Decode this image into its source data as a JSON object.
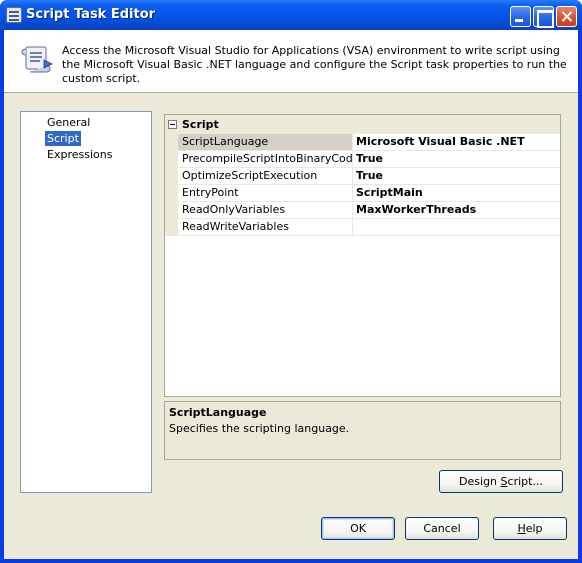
{
  "window": {
    "title": "Script Task Editor"
  },
  "header": {
    "description": "Access the Microsoft Visual Studio for Applications (VSA) environment to write script using the Microsoft Visual Basic .NET language and configure the Script task properties to run the custom script.",
    "icon": "script-scroll-icon"
  },
  "nav": {
    "items": [
      {
        "label": "General",
        "selected": false
      },
      {
        "label": "Script",
        "selected": true
      },
      {
        "label": "Expressions",
        "selected": false
      }
    ]
  },
  "grid": {
    "category": "Script",
    "rows": [
      {
        "name": "ScriptLanguage",
        "value": "Microsoft Visual Basic .NET"
      },
      {
        "name": "PrecompileScriptIntoBinaryCode",
        "value": "True"
      },
      {
        "name": "OptimizeScriptExecution",
        "value": "True"
      },
      {
        "name": "EntryPoint",
        "value": "ScriptMain"
      },
      {
        "name": "ReadOnlyVariables",
        "value": "MaxWorkerThreads"
      },
      {
        "name": "ReadWriteVariables",
        "value": ""
      }
    ]
  },
  "description": {
    "title": "ScriptLanguage",
    "text": "Specifies the scripting language."
  },
  "buttons": {
    "design_script": {
      "pre": "Design ",
      "access": "S",
      "post": "cript..."
    },
    "ok": "OK",
    "cancel": "Cancel",
    "help": {
      "access": "H",
      "post": "elp"
    }
  },
  "colors": {
    "titlebar": "#0653e6",
    "selection": "#316ac5",
    "face": "#ece9d8"
  }
}
